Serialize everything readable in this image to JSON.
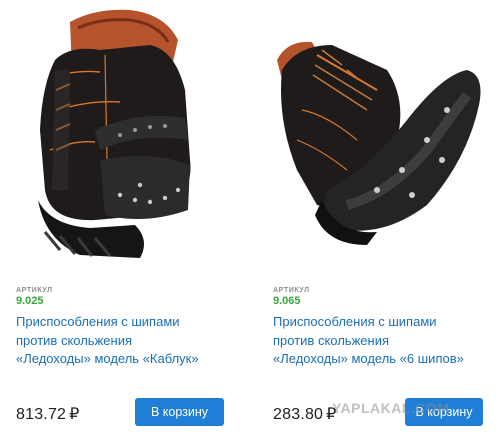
{
  "products": [
    {
      "article_label": "АРТИКУЛ",
      "sku": "9.025",
      "title_lines": [
        "Приспособления с шипами",
        "против скольжения",
        "«Ледоходы» модель «Каблук»"
      ],
      "price": "813.72",
      "currency": "₽",
      "cart_label": "В корзину",
      "image_icon": "boot-heel-ice-cleat-image"
    },
    {
      "article_label": "АРТИКУЛ",
      "sku": "9.065",
      "title_lines": [
        "Приспособления с шипами",
        "против скольжения",
        "«Ледоходы» модель «6 шипов»"
      ],
      "price": "283.80",
      "currency": "₽",
      "cart_label": "В корзину",
      "image_icon": "boot-sole-six-spike-image"
    }
  ],
  "watermark": "YAPLAKAL.COM",
  "colors": {
    "sku": "#3aa53a",
    "title": "#1a6fb5",
    "button": "#1f7fd6",
    "price": "#1f1f1f"
  }
}
